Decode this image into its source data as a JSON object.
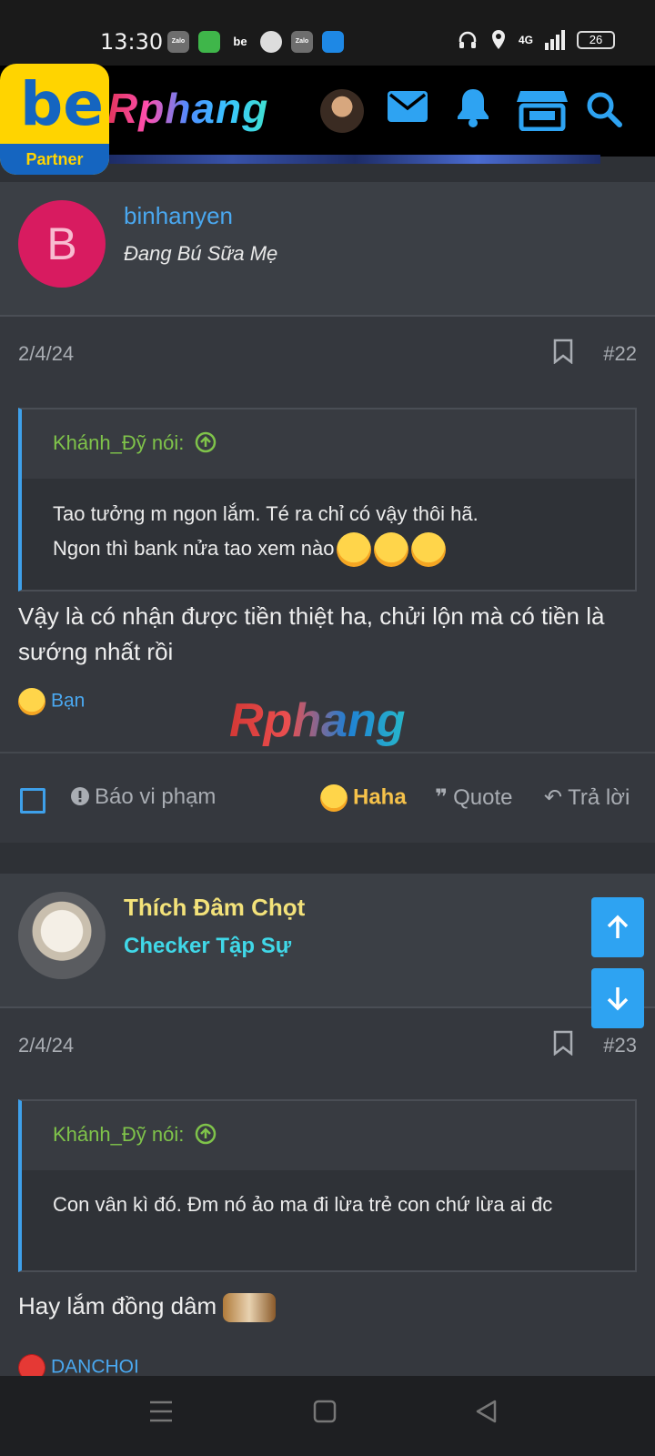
{
  "status_bar": {
    "time": "13:30",
    "app_icons": [
      "Zalo",
      "",
      "be",
      "",
      "Zalo",
      ""
    ],
    "network": "4G",
    "battery": "26"
  },
  "header": {
    "site_logo": "Rphang",
    "partner_badge": {
      "brand": "be",
      "label": "Partner"
    },
    "icons": [
      "avatar",
      "mail-icon",
      "bell-icon",
      "store-icon",
      "search-icon"
    ]
  },
  "posts": [
    {
      "username": "binhanyen",
      "user_title": "Đang Bú Sữa Mẹ",
      "avatar_letter": "B",
      "date": "2/4/24",
      "post_number": "#22",
      "quote": {
        "header": "Khánh_Đỹ nói:",
        "line1": "Tao tưởng m ngon lắm. Té ra chỉ có vậy thôi hã.",
        "line2": "Ngon thì bank nửa tao xem nào"
      },
      "body": "Vậy là có nhận được tiền thiệt ha, chửi lộn mà có tiền là sướng nhất rồi",
      "reaction_by": "Bạn",
      "actions": {
        "report": "Báo vi phạm",
        "haha": "Haha",
        "quote": "Quote",
        "reply": "Trả lời"
      }
    },
    {
      "username": "Thích Đâm Chọt",
      "user_title": "Checker Tập Sự",
      "date": "2/4/24",
      "post_number": "#23",
      "quote": {
        "header": "Khánh_Đỹ nói:",
        "body": "Con vân kì đó. Đm nó ảo ma đi lừa trẻ con chứ lừa ai đc"
      },
      "body": "Hay lắm đồng dâm",
      "reaction_by": "DANCHOI"
    }
  ],
  "watermark": "Rphang",
  "colors": {
    "accent_blue": "#2ea3f2",
    "quote_green": "#7fc34a",
    "username_blue": "#4aa8f0",
    "username_yellow": "#f3e27a",
    "title_cyan": "#40d8e8",
    "haha_gold": "#f6c24a"
  }
}
